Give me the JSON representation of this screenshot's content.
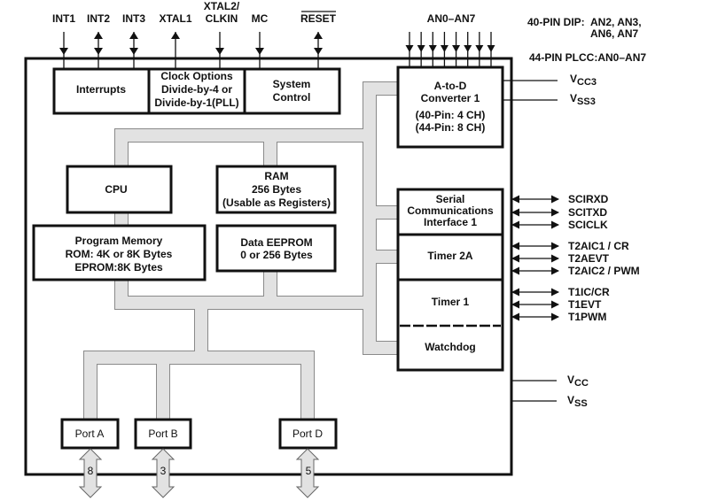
{
  "top_pins": [
    {
      "label": "INT1",
      "direction": "in"
    },
    {
      "label": "INT2",
      "direction": "bidirectional"
    },
    {
      "label": "INT3",
      "direction": "bidirectional"
    },
    {
      "label": "XTAL1",
      "direction": "out"
    },
    {
      "label_line1": "XTAL2/",
      "label_line2": "CLKIN",
      "direction": "in"
    },
    {
      "label": "MC",
      "direction": "in"
    },
    {
      "label": "RESET",
      "direction": "bidirectional",
      "overline": true
    }
  ],
  "analog_pins": {
    "label": "AN0–AN7",
    "count": 8
  },
  "pin_notes": {
    "dip_label": "40-PIN DIP:",
    "dip_line1": "AN2, AN3,",
    "dip_line2": "AN6, AN7",
    "plcc": "44-PIN PLCC:AN0–AN7"
  },
  "blocks": {
    "interrupts": "Interrupts",
    "clock": [
      "Clock Options",
      "Divide-by-4 or",
      "Divide-by-1(PLL)"
    ],
    "system": [
      "System",
      "Control"
    ],
    "adc": [
      "A-to-D",
      "Converter 1",
      "(40-Pin: 4 CH)",
      "(44-Pin: 8 CH)"
    ],
    "cpu": "CPU",
    "ram": [
      "RAM",
      "256 Bytes",
      "(Usable as Registers)"
    ],
    "program_memory": [
      "Program Memory",
      "ROM: 4K or 8K Bytes",
      "EPROM:8K Bytes"
    ],
    "eeprom": [
      "Data EEPROM",
      "0 or 256 Bytes"
    ],
    "sci": [
      "Serial",
      "Communications",
      "Interface 1"
    ],
    "timer2a": "Timer 2A",
    "timer1": "Timer 1",
    "watchdog": "Watchdog",
    "ports": [
      {
        "label": "Port A",
        "width": "8"
      },
      {
        "label": "Port B",
        "width": "3"
      },
      {
        "label": "Port D",
        "width": "5"
      }
    ]
  },
  "power_pins": [
    {
      "main": "V",
      "sub": "CC3"
    },
    {
      "main": "V",
      "sub": "SS3"
    },
    {
      "main": "V",
      "sub": "CC"
    },
    {
      "main": "V",
      "sub": "SS"
    }
  ],
  "side_pins": {
    "sci": [
      "SCIRXD",
      "SCITXD",
      "SCICLK"
    ],
    "timer2a": [
      "T2AIC1 / CR",
      "T2AEVT",
      "T2AIC2 / PWM"
    ],
    "timer1": [
      "T1IC/CR",
      "T1EVT",
      "T1PWM"
    ]
  }
}
